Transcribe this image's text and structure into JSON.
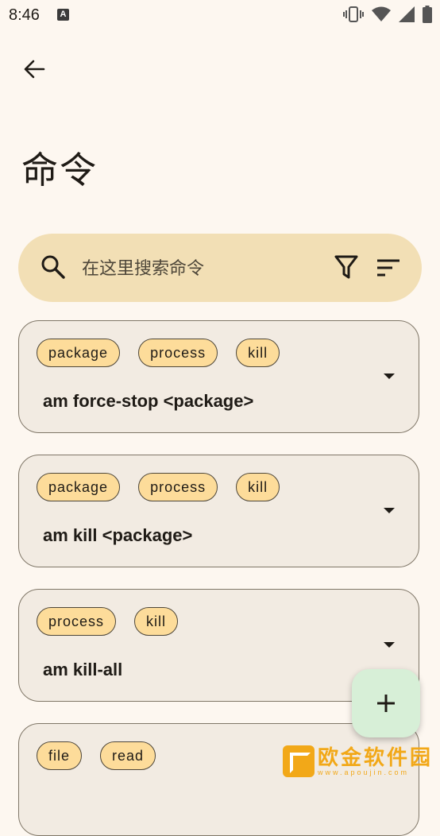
{
  "status_bar": {
    "time": "8:46",
    "notification_icon_letter": "A",
    "icons": [
      "vibrate-icon",
      "wifi-icon",
      "signal-icon",
      "battery-icon"
    ]
  },
  "header": {
    "back_icon": "arrow-back-icon",
    "title": "命令"
  },
  "search": {
    "placeholder": "在这里搜索命令",
    "value": "",
    "icons": [
      "search-icon",
      "filter-icon",
      "sort-icon"
    ]
  },
  "commands": [
    {
      "tags": [
        "package",
        "process",
        "kill"
      ],
      "command": "am force-stop <package>"
    },
    {
      "tags": [
        "package",
        "process",
        "kill"
      ],
      "command": "am kill <package>"
    },
    {
      "tags": [
        "process",
        "kill"
      ],
      "command": "am kill-all"
    },
    {
      "tags": [
        "file",
        "read"
      ],
      "command": ""
    }
  ],
  "fab": {
    "icon": "plus-icon"
  },
  "watermark": {
    "text": "欧金软件园",
    "url": "www.apoujin.com"
  },
  "colors": {
    "background": "#fdf7f0",
    "search_bg": "#f2dfb5",
    "card_bg": "#f2ebe2",
    "chip_bg": "#fddc9a",
    "fab_bg": "#d7efd7",
    "watermark": "#f2a818"
  }
}
